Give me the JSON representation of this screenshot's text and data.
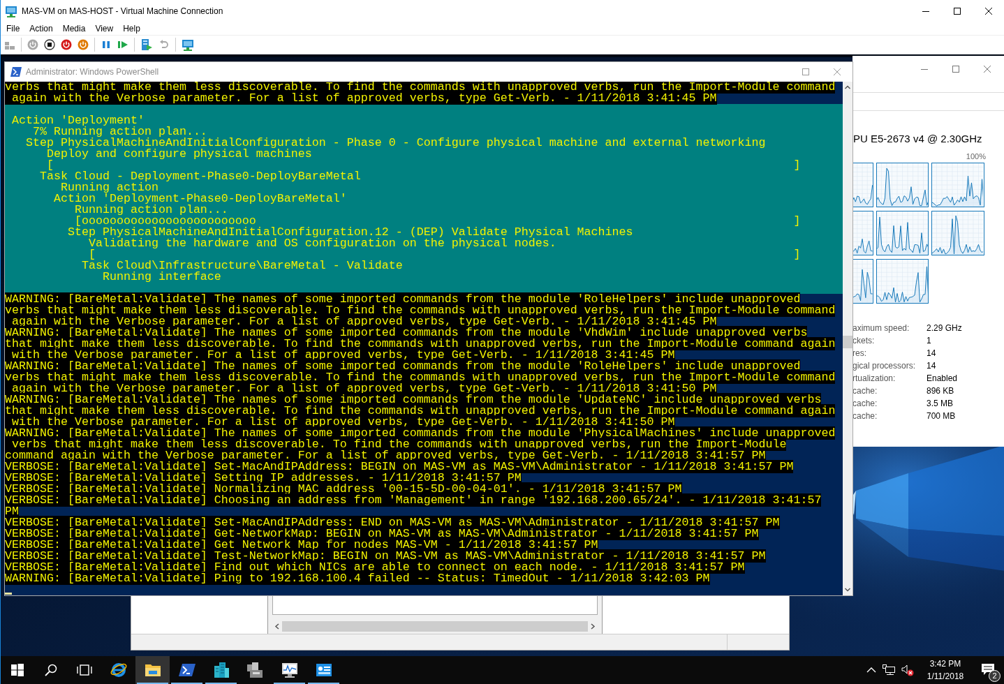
{
  "window": {
    "title": "MAS-VM on MAS-HOST - Virtual Machine Connection"
  },
  "menu": [
    "File",
    "Action",
    "Media",
    "View",
    "Help"
  ],
  "toolbar": [
    {
      "kind": "ctrl-alt-del",
      "disabled": true
    },
    {
      "kind": "separator"
    },
    {
      "kind": "start",
      "disabled": true
    },
    {
      "kind": "turn-off",
      "disabled": false
    },
    {
      "kind": "shut-down",
      "disabled": false
    },
    {
      "kind": "save",
      "disabled": false
    },
    {
      "kind": "separator"
    },
    {
      "kind": "pause",
      "disabled": false
    },
    {
      "kind": "reset",
      "disabled": false
    },
    {
      "kind": "separator"
    },
    {
      "kind": "checkpoint",
      "disabled": false
    },
    {
      "kind": "revert",
      "disabled": true
    },
    {
      "kind": "separator"
    },
    {
      "kind": "enhanced-session",
      "disabled": false
    }
  ],
  "powershell": {
    "title": "Administrator: Windows PowerShell",
    "output_before": [
      "verbs that might make them less discoverable. To find the commands with unapproved verbs, run the Import-Module command",
      " again with the Verbose parameter. For a list of approved verbs, type Get-Verb. - 1/11/2018 3:41:45 PM"
    ],
    "progress": [
      {
        "text": " Action 'Deployment'"
      },
      {
        "text": "    7% Running action plan..."
      },
      {
        "text": "   Step PhysicalMachineAndInitialConfiguration - Phase 0 - Configure physical machine and external networking"
      },
      {
        "text": "      Deploy and configure physical machines"
      },
      {
        "text": "      [",
        "end": "]"
      },
      {
        "text": "     Task Cloud - Deployment-Phase0-DeployBareMetal"
      },
      {
        "text": "        Running action"
      },
      {
        "text": "       Action 'Deployment-Phase0-DeployBareMetal'"
      },
      {
        "text": "          Running action plan..."
      },
      {
        "text": "          [ooooooooooooooooooooooooo",
        "end": "]"
      },
      {
        "text": "         Step PhysicalMachineAndInitialConfiguration.12 - (DEP) Validate Physical Machines"
      },
      {
        "text": "            Validating the hardware and OS configuration on the physical nodes."
      },
      {
        "text": "            [",
        "end": "]"
      },
      {
        "text": "           Task Cloud\\Infrastructure\\BareMetal - Validate"
      },
      {
        "text": "              Running interface"
      }
    ],
    "output_after": [
      "WARNING: [BareMetal:Validate] The names of some imported commands from the module 'RoleHelpers' include unapproved",
      "verbs that might make them less discoverable. To find the commands with unapproved verbs, run the Import-Module command",
      " again with the Verbose parameter. For a list of approved verbs, type Get-Verb. - 1/11/2018 3:41:45 PM",
      "WARNING: [BareMetal:Validate] The names of some imported commands from the module 'VhdWim' include unapproved verbs",
      "that might make them less discoverable. To find the commands with unapproved verbs, run the Import-Module command again",
      " with the Verbose parameter. For a list of approved verbs, type Get-Verb. - 1/11/2018 3:41:45 PM",
      "WARNING: [BareMetal:Validate] The names of some imported commands from the module 'RoleHelpers' include unapproved",
      "verbs that might make them less discoverable. To find the commands with unapproved verbs, run the Import-Module command",
      " again with the Verbose parameter. For a list of approved verbs, type Get-Verb. - 1/11/2018 3:41:50 PM",
      "WARNING: [BareMetal:Validate] The names of some imported commands from the module 'UpdateNC' include unapproved verbs",
      "that might make them less discoverable. To find the commands with unapproved verbs, run the Import-Module command again",
      " with the Verbose parameter. For a list of approved verbs, type Get-Verb. - 1/11/2018 3:41:50 PM",
      "WARNING: [BareMetal:Validate] The names of some imported commands from the module 'PhysicalMachines' include unapproved",
      " verbs that might make them less discoverable. To find the commands with unapproved verbs, run the Import-Module",
      "command again with the Verbose parameter. For a list of approved verbs, type Get-Verb. - 1/11/2018 3:41:57 PM",
      "VERBOSE: [BareMetal:Validate] Set-MacAndIPAddress: BEGIN on MAS-VM as MAS-VM\\Administrator - 1/11/2018 3:41:57 PM",
      "VERBOSE: [BareMetal:Validate] Setting IP addresses. - 1/11/2018 3:41:57 PM",
      "VERBOSE: [BareMetal:Validate] Normalizing MAC address '00-15-5D-00-04-01'. - 1/11/2018 3:41:57 PM",
      "VERBOSE: [BareMetal:Validate] Choosing an address from 'Management' in range '192.168.200.65/24'. - 1/11/2018 3:41:57",
      "PM",
      "VERBOSE: [BareMetal:Validate] Set-MacAndIPAddress: END on MAS-VM as MAS-VM\\Administrator - 1/11/2018 3:41:57 PM",
      "VERBOSE: [BareMetal:Validate] Get-NetworkMap: BEGIN on MAS-VM as MAS-VM\\Administrator - 1/11/2018 3:41:57 PM",
      "VERBOSE: [BareMetal:Validate] Get Network Map for nodes MAS-VM - 1/11/2018 3:41:57 PM",
      "VERBOSE: [BareMetal:Validate] Test-NetworkMap: BEGIN on MAS-VM as MAS-VM\\Administrator - 1/11/2018 3:41:57 PM",
      "VERBOSE: [BareMetal:Validate] Find out which NICs are able to connect on each node. - 1/11/2018 3:41:57 PM",
      "WARNING: [BareMetal:Validate] Ping to 192.168.100.4 failed -- Status: TimedOut - 1/11/2018 3:42:03 PM"
    ]
  },
  "task_manager": {
    "cpu_name": "PU E5-2673 v4 @ 2.30GHz",
    "scale_max": "100%",
    "specs": [
      {
        "label": "aximum speed:",
        "value": "2.29 GHz"
      },
      {
        "label": "ckets:",
        "value": "1"
      },
      {
        "label": "res:",
        "value": "14"
      },
      {
        "label": "gical processors:",
        "value": "14"
      },
      {
        "label": "rtualization:",
        "value": "Enabled"
      },
      {
        "label": "cache:",
        "value": "896 KB"
      },
      {
        "label": "cache:",
        "value": "3.5 MB"
      },
      {
        "label": "cache:",
        "value": "700 MB"
      }
    ]
  },
  "taskbar": {
    "buttons": [
      {
        "kind": "start"
      },
      {
        "kind": "search"
      },
      {
        "kind": "task-view"
      }
    ],
    "apps": [
      {
        "kind": "browser",
        "open": false,
        "selected": false
      },
      {
        "kind": "file-explorer",
        "open": true,
        "selected": true
      },
      {
        "kind": "powershell",
        "open": true,
        "selected": false
      },
      {
        "kind": "server-manager",
        "open": true,
        "selected": false
      },
      {
        "kind": "tools",
        "open": false,
        "selected": false
      },
      {
        "kind": "performance-monitor",
        "open": true,
        "selected": false
      },
      {
        "kind": "dashboard",
        "open": true,
        "selected": false
      }
    ],
    "time": "3:42 PM",
    "date": "1/11/2018",
    "notifications": "2"
  }
}
